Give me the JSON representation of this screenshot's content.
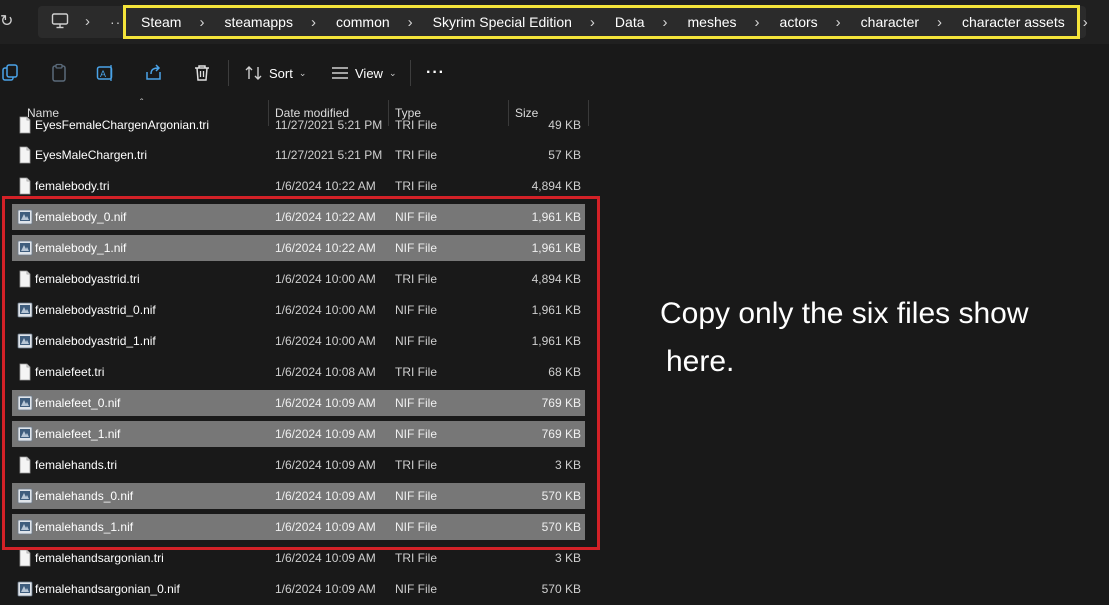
{
  "address_bar": {
    "overflow": "··",
    "breadcrumbs": [
      "Steam",
      "steamapps",
      "common",
      "Skyrim Special Edition",
      "Data",
      "meshes",
      "actors",
      "character",
      "character assets"
    ]
  },
  "toolbar": {
    "sort_label": "Sort",
    "view_label": "View",
    "more": "···"
  },
  "columns": {
    "name": "Name",
    "date": "Date modified",
    "type": "Type",
    "size": "Size"
  },
  "files": [
    {
      "name": "EyesFemaleChargenArgonian.tri",
      "date": "11/27/2021 5:21 PM",
      "type": "TRI File",
      "size": "49 KB",
      "icon": "file-icon",
      "selected": false
    },
    {
      "name": "EyesMaleChargen.tri",
      "date": "11/27/2021 5:21 PM",
      "type": "TRI File",
      "size": "57 KB",
      "icon": "file-icon",
      "selected": false
    },
    {
      "name": "femalebody.tri",
      "date": "1/6/2024 10:22 AM",
      "type": "TRI File",
      "size": "4,894 KB",
      "icon": "file-icon",
      "selected": false
    },
    {
      "name": "femalebody_0.nif",
      "date": "1/6/2024 10:22 AM",
      "type": "NIF File",
      "size": "1,961 KB",
      "icon": "nif-file-icon",
      "selected": true
    },
    {
      "name": "femalebody_1.nif",
      "date": "1/6/2024 10:22 AM",
      "type": "NIF File",
      "size": "1,961 KB",
      "icon": "nif-file-icon",
      "selected": true
    },
    {
      "name": "femalebodyastrid.tri",
      "date": "1/6/2024 10:00 AM",
      "type": "TRI File",
      "size": "4,894 KB",
      "icon": "file-icon",
      "selected": false
    },
    {
      "name": "femalebodyastrid_0.nif",
      "date": "1/6/2024 10:00 AM",
      "type": "NIF File",
      "size": "1,961 KB",
      "icon": "nif-file-icon",
      "selected": false
    },
    {
      "name": "femalebodyastrid_1.nif",
      "date": "1/6/2024 10:00 AM",
      "type": "NIF File",
      "size": "1,961 KB",
      "icon": "nif-file-icon",
      "selected": false
    },
    {
      "name": "femalefeet.tri",
      "date": "1/6/2024 10:08 AM",
      "type": "TRI File",
      "size": "68 KB",
      "icon": "file-icon",
      "selected": false
    },
    {
      "name": "femalefeet_0.nif",
      "date": "1/6/2024 10:09 AM",
      "type": "NIF File",
      "size": "769 KB",
      "icon": "nif-file-icon",
      "selected": true
    },
    {
      "name": "femalefeet_1.nif",
      "date": "1/6/2024 10:09 AM",
      "type": "NIF File",
      "size": "769 KB",
      "icon": "nif-file-icon",
      "selected": true
    },
    {
      "name": "femalehands.tri",
      "date": "1/6/2024 10:09 AM",
      "type": "TRI File",
      "size": "3 KB",
      "icon": "file-icon",
      "selected": false
    },
    {
      "name": "femalehands_0.nif",
      "date": "1/6/2024 10:09 AM",
      "type": "NIF File",
      "size": "570 KB",
      "icon": "nif-file-icon",
      "selected": true
    },
    {
      "name": "femalehands_1.nif",
      "date": "1/6/2024 10:09 AM",
      "type": "NIF File",
      "size": "570 KB",
      "icon": "nif-file-icon",
      "selected": true
    },
    {
      "name": "femalehandsargonian.tri",
      "date": "1/6/2024 10:09 AM",
      "type": "TRI File",
      "size": "3 KB",
      "icon": "file-icon",
      "selected": false
    },
    {
      "name": "femalehandsargonian_0.nif",
      "date": "1/6/2024 10:09 AM",
      "type": "NIF File",
      "size": "570 KB",
      "icon": "nif-file-icon",
      "selected": false
    }
  ],
  "annotation": {
    "line1": "Copy only the six files show",
    "line2": "here."
  },
  "colors": {
    "highlight_yellow": "#f4e43a",
    "highlight_red": "#d32127",
    "selection": "#777777",
    "background": "#191919"
  }
}
